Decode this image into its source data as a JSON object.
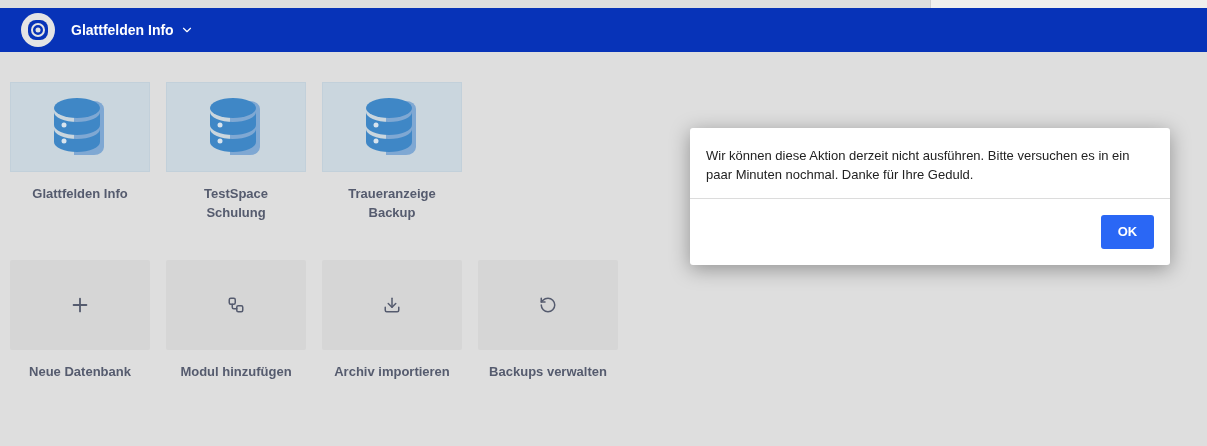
{
  "header": {
    "title": "Glattfelden Info"
  },
  "databases": [
    {
      "label": "Glattfelden Info"
    },
    {
      "label": "TestSpace Schulung"
    },
    {
      "label": "Traueranzeige Backup"
    }
  ],
  "actions": [
    {
      "kind": "add",
      "label": "Neue Datenbank"
    },
    {
      "kind": "module",
      "label": "Modul hinzufügen"
    },
    {
      "kind": "import",
      "label": "Archiv importieren"
    },
    {
      "kind": "backup",
      "label": "Backups verwalten"
    }
  ],
  "dialog": {
    "message": "Wir können diese Aktion derzeit nicht ausführen. Bitte versuchen es in ein paar Minuten nochmal. Danke für Ihre Geduld.",
    "button": "OK"
  }
}
